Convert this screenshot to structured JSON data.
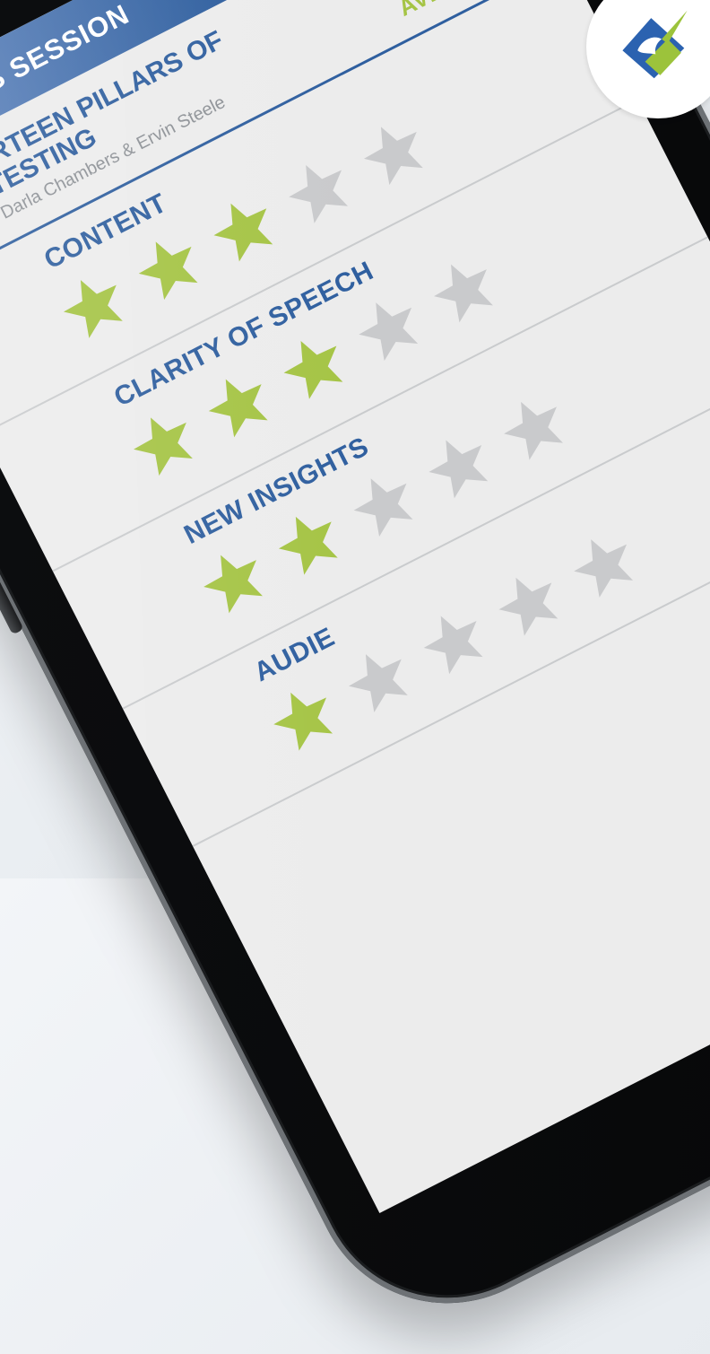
{
  "header": {
    "title": "RATE THIS SESSION",
    "close_symbol": "✖"
  },
  "session": {
    "title": "THE THIRTEEN PILLARS OF AGILE TESTING",
    "subtitle": "Tutorial by Darla Chambers & Ervin Steele"
  },
  "scale_label": "AVERAGE",
  "ratings": [
    {
      "label": "CONTENT",
      "filled": 3,
      "total": 5
    },
    {
      "label": "CLARITY OF SPEECH",
      "filled": 3,
      "total": 5
    },
    {
      "label": "NEW INSIGHTS",
      "filled": 2,
      "total": 5
    },
    {
      "label": "AUDIE",
      "filled": 1,
      "total": 5
    }
  ],
  "colors": {
    "header_blue": "#2e5e9e",
    "accent_green": "#a5c445",
    "star_empty": "#c9cacc",
    "text_blue": "#2f5f9f"
  },
  "icons": {
    "close": "close-icon",
    "logo": "unicorn-logo-icon",
    "star": "star-icon"
  }
}
